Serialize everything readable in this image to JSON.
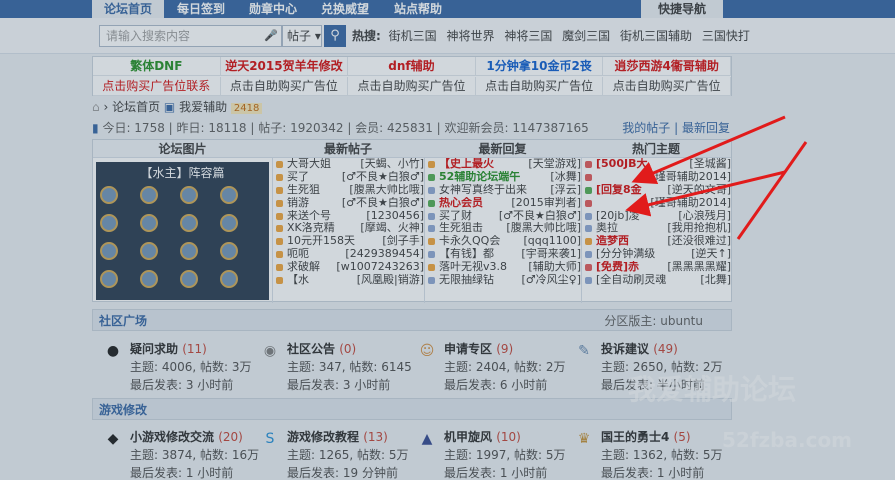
{
  "topnav": {
    "tabs": [
      "论坛首页",
      "每日签到",
      "勋章中心",
      "兑换威望",
      "站点帮助"
    ],
    "quick": "快捷导航"
  },
  "search": {
    "placeholder": "请输入搜索内容",
    "scope": "帖子",
    "hot_label": "热搜:",
    "hot": [
      "街机三国",
      "神将世界",
      "神将三国",
      "魔剑三国",
      "街机三国辅助",
      "三国快打"
    ]
  },
  "ads": [
    {
      "text": "繁体DNF",
      "color": "#1a8a1a"
    },
    {
      "text": "逆天2015贺羊年修改",
      "color": "#d40000"
    },
    {
      "text": "dnf辅助",
      "color": "#d40000"
    },
    {
      "text": "1分钟拿10金币2丧",
      "color": "#0055cc"
    },
    {
      "text": "逍莎西游4衞哥辅助",
      "color": "#d40000"
    },
    {
      "text": "点击购买广告位联系",
      "color": "#d40000"
    },
    {
      "text": "点击自助购买广告位",
      "color": "#333333"
    },
    {
      "text": "点击自助购买广告位",
      "color": "#333333"
    },
    {
      "text": "点击自助购买广告位",
      "color": "#333333"
    },
    {
      "text": "点击自助购买广告位",
      "color": "#333333"
    }
  ],
  "breadcrumb": {
    "home": "论坛首页",
    "forum": "我爱辅助",
    "count": "2418"
  },
  "stats": {
    "text": "今日: 1758 | 昨日: 18118 | 帖子: 1920342 | 会员: 425831 | 欢迎新会员: 1147387165",
    "my_posts": "我的帖子",
    "latest_reply": "最新回复"
  },
  "portal": {
    "headers": [
      "论坛图片",
      "最新帖子",
      "最新回复",
      "热门主题"
    ],
    "image_caption": "【水主】阵容篇",
    "latest_posts": [
      {
        "t": "大哥大姐",
        "a": "[天蝎、小竹]"
      },
      {
        "t": "买了",
        "a": "[♂不良★白狼♂]"
      },
      {
        "t": "生死狙",
        "a": "[腹黑大帅比哦]"
      },
      {
        "t": "销游",
        "a": "[♂不良★白狼♂]"
      },
      {
        "t": "来送个号",
        "a": "[1230456]"
      },
      {
        "t": "XK洛克精",
        "a": "[摩竭、火神]"
      },
      {
        "t": "10元开158天",
        "a": "[剑子手]"
      },
      {
        "t": "呃呃",
        "a": "[2429389454]"
      },
      {
        "t": "求破解",
        "a": "[w1007243263]"
      },
      {
        "t": "【水",
        "a": "[风凰殿|销游]"
      }
    ],
    "latest_replies": [
      {
        "t": "【史上最火",
        "a": "[天堂游戏]",
        "c": "#d40000"
      },
      {
        "t": "52辅助论坛端午",
        "a": "[冰舞]",
        "c": "#1a8a1a"
      },
      {
        "t": "女神写真终于出来",
        "a": "[浮云]",
        "c": "#333333"
      },
      {
        "t": "热心会员",
        "a": "[2015审判者]",
        "c": "#d40000"
      },
      {
        "t": "买了财",
        "a": "[♂不良★白狼♂]",
        "c": "#333333"
      },
      {
        "t": "生死狙击",
        "a": "[腹黑大帅比哦]",
        "c": "#333333"
      },
      {
        "t": "卡永久QQ会",
        "a": "[qqq1100]",
        "c": "#333333"
      },
      {
        "t": "【有钱】都",
        "a": "[宇哥来袭1]",
        "c": "#333333"
      },
      {
        "t": "落叶无视v3.8",
        "a": "[辅助大师]",
        "c": "#333333"
      },
      {
        "t": "无限抽绿钻",
        "a": "[♂冷风尘♀]",
        "c": "#333333"
      }
    ],
    "hot_topics": [
      {
        "t": "[500JB大",
        "a": "[圣城酱]",
        "c": "#d40000"
      },
      {
        "t": "",
        "a": "[瑾哥辅助2014]",
        "c": "#333333"
      },
      {
        "t": "[回复8金",
        "a": "[逆天的文哥]",
        "c": "#d40000"
      },
      {
        "t": "",
        "a": "[瑾哥辅助2014]",
        "c": "#333333"
      },
      {
        "t": "[20jb]凌",
        "a": "[心浪残月]",
        "c": "#333333"
      },
      {
        "t": "奥拉",
        "a": "[我用抢抱机]",
        "c": "#333333"
      },
      {
        "t": "造梦西",
        "a": "[还没很难过]",
        "c": "#d40000"
      },
      {
        "t": "[分分钟满级",
        "a": "[逆天↑]",
        "c": "#333333"
      },
      {
        "t": "[免费]赤",
        "a": "[黑黑黑黑耀]",
        "c": "#d40000"
      },
      {
        "t": "[全自动刷灵魂",
        "a": "[北舞]",
        "c": "#333333"
      }
    ]
  },
  "community": {
    "title": "社区广场",
    "moderator": "分区版主: ubuntu",
    "forums": [
      {
        "name": "疑问求助",
        "count": "(11)",
        "l1": "主题: 4006, 帖数: 3万",
        "l2": "最后发表: 3 小时前",
        "icon": "paw-icon",
        "color": "#111111"
      },
      {
        "name": "社区公告",
        "count": "(0)",
        "l1": "主题: 347, 帖数: 6145",
        "l2": "最后发表: 3 小时前",
        "icon": "speaker-icon",
        "color": "#777777"
      },
      {
        "name": "申请专区",
        "count": "(9)",
        "l1": "主题: 2404, 帖数: 2万",
        "l2": "最后发表: 6 小时前",
        "icon": "person-icon",
        "color": "#d08a3a"
      },
      {
        "name": "投诉建议",
        "count": "(49)",
        "l1": "主题: 2650, 帖数: 2万",
        "l2": "最后发表: 半小时前",
        "icon": "pen-icon",
        "color": "#5b7fa8"
      }
    ]
  },
  "games": {
    "title": "游戏修改",
    "forums": [
      {
        "name": "小游戏修改交流",
        "count": "(20)",
        "l1": "主题: 3874, 帖数: 16万",
        "l2": "最后发表: 1 小时前",
        "icon": "penguin-icon",
        "color": "#111111"
      },
      {
        "name": "游戏修改教程",
        "count": "(13)",
        "l1": "主题: 1265, 帖数: 5万",
        "l2": "最后发表: 19 分钟前",
        "icon": "skype-icon",
        "color": "#1a8ad4"
      },
      {
        "name": "机甲旋风",
        "count": "(10)",
        "l1": "主题: 1997, 帖数: 5万",
        "l2": "最后发表: 1 小时前",
        "icon": "mecha-icon",
        "color": "#2a3f8a"
      },
      {
        "name": "国王的勇士4",
        "count": "(5)",
        "l1": "主题: 1362, 帖数: 5万",
        "l2": "最后发表: 1 小时前",
        "icon": "king-icon",
        "color": "#c08a2a"
      }
    ]
  },
  "watermark": {
    "big": "我爱辅助论坛",
    "small": "52fzba.com"
  }
}
